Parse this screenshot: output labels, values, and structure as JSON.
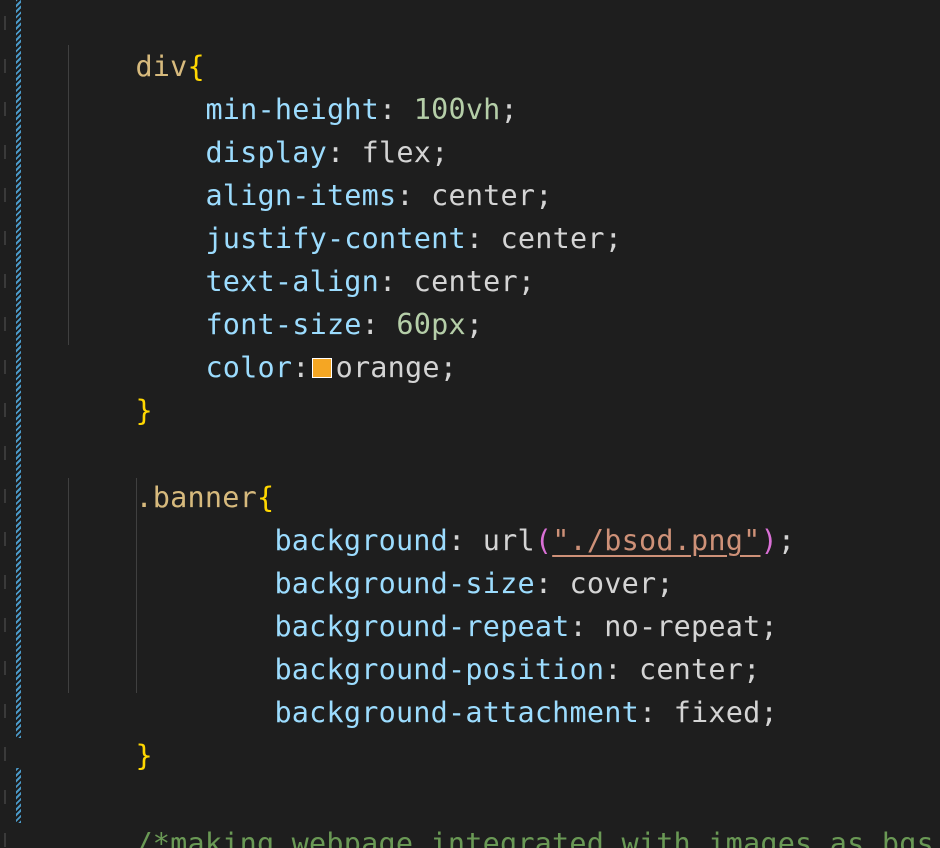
{
  "editor": {
    "color_swatch_hex": "#f5a623",
    "lines": {
      "div_selector": "div",
      "div_open": "{",
      "min_height_prop": "min-height",
      "min_height_num": "100",
      "min_height_unit": "vh",
      "display_prop": "display",
      "display_val": "flex",
      "align_items_prop": "align-items",
      "align_items_val": "center",
      "justify_content_prop": "justify-content",
      "justify_content_val": "center",
      "text_align_prop": "text-align",
      "text_align_val": "center",
      "font_size_prop": "font-size",
      "font_size_num": "60",
      "font_size_unit": "px",
      "color_prop": "color",
      "color_val": "orange",
      "div_close": "}",
      "banner_selector": ".banner",
      "banner_open": "{",
      "background_prop": "background",
      "background_func": "url",
      "background_string": "\"./bsod.png\"",
      "background_size_prop": "background-size",
      "background_size_val": "cover",
      "background_repeat_prop": "background-repeat",
      "background_repeat_val": "no-repeat",
      "background_position_prop": "background-position",
      "background_position_val": "center",
      "background_attachment_prop": "background-attachment",
      "background_attachment_val": "fixed",
      "banner_close": "}",
      "comment": "/*making webpage integrated with images as bgs.*/"
    }
  }
}
